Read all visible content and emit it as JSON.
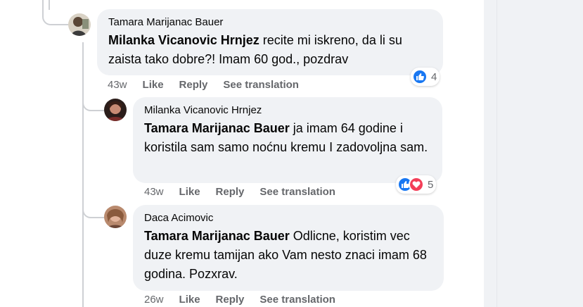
{
  "colors": {
    "like_blue": "#1877f2",
    "love_red": "#f33e58",
    "bubble_bg": "#f0f2f5",
    "meta_gray": "#65676b"
  },
  "comments": [
    {
      "author": "Tamara Marijanac Bauer",
      "mention": "Milanka Vicanovic Hrnjez",
      "text": " recite mi iskreno, da li su zaista tako dobre?! Imam 60 god., pozdrav",
      "time": "43w",
      "like_label": "Like",
      "reply_label": "Reply",
      "translate_label": "See translation",
      "reactions": {
        "icons": [
          "like-icon"
        ],
        "count": "4"
      }
    },
    {
      "author": "Milanka Vicanovic Hrnjez",
      "mention": "Tamara Marijanac Bauer",
      "text": " ja imam 64 godine i koristila sam samo noćnu kremu I zadovoljna sam.",
      "time": "43w",
      "like_label": "Like",
      "reply_label": "Reply",
      "translate_label": "See translation",
      "reactions": {
        "icons": [
          "like-icon",
          "love-icon"
        ],
        "count": "5"
      }
    },
    {
      "author": "Daca Acimovic",
      "mention": "Tamara Marijanac Bauer",
      "text": " Odlicne, koristim vec duze kremu tamijan ako Vam nesto znaci imam 68 godina. Pozxrav.",
      "time": "26w",
      "like_label": "Like",
      "reply_label": "Reply",
      "translate_label": "See translation"
    }
  ]
}
